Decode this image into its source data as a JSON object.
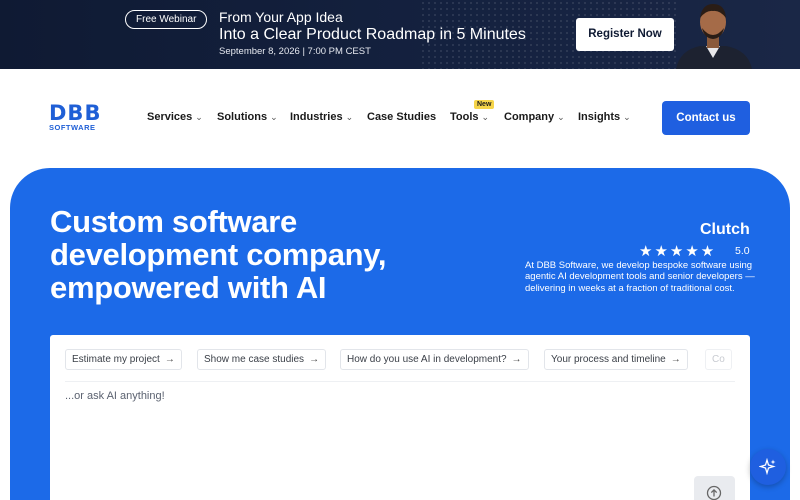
{
  "banner": {
    "pill_label": "Free Webinar",
    "line1": "From Your App Idea",
    "line2": "Into a Clear Product Roadmap in 5 Minutes",
    "date": "September 8, 2026 | 7:00 PM CEST",
    "register_label": "Register Now"
  },
  "header": {
    "logo_main": "DBB",
    "logo_sub": "SOFTWARE",
    "nav": [
      {
        "label": "Services",
        "dropdown": true
      },
      {
        "label": "Solutions",
        "dropdown": true
      },
      {
        "label": "Industries",
        "dropdown": true
      },
      {
        "label": "Case Studies",
        "dropdown": false
      },
      {
        "label": "Tools",
        "dropdown": true
      },
      {
        "label": "Company",
        "dropdown": true
      },
      {
        "label": "Insights",
        "dropdown": true
      }
    ],
    "tools_badge": "New",
    "contact_label": "Contact us"
  },
  "hero": {
    "title": "Custom software development company, empowered with AI",
    "clutch_label": "Clutch",
    "stars": "★★★★★",
    "rating": "5.0",
    "description": "At DBB Software, we develop bespoke software using agentic AI development tools and senior developers — delivering in weeks at a fraction of traditional cost."
  },
  "ai_panel": {
    "chips": [
      "Estimate my project",
      "Show me case studies",
      "How do you use AI in development?",
      "Your process and timeline",
      "Co"
    ],
    "input_placeholder": "...or ask AI anything!"
  },
  "colors": {
    "brand_blue": "#1c6ae8",
    "banner_dark": "#0f1a33",
    "badge_yellow": "#f6d54a"
  },
  "icons": {
    "chip_arrow": "arrow-right-icon",
    "send": "arrow-up-circle-icon",
    "assistant": "sparkle-icon",
    "nav_dropdown": "chevron-down-icon"
  }
}
